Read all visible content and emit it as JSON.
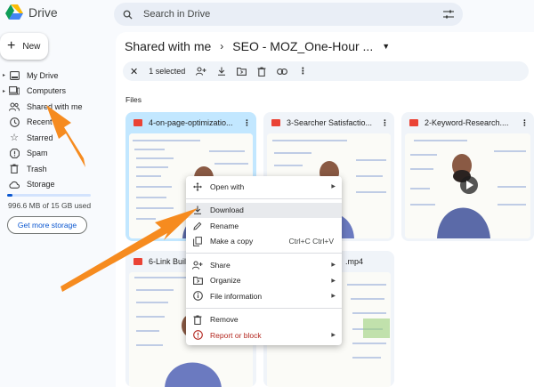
{
  "app": {
    "name": "Drive"
  },
  "search": {
    "placeholder": "Search in Drive"
  },
  "sidebar": {
    "new_label": "New",
    "items": [
      {
        "label": "My Drive",
        "icon": "my-drive-icon"
      },
      {
        "label": "Computers",
        "icon": "computer-icon"
      },
      {
        "label": "Shared with me",
        "icon": "shared-icon"
      },
      {
        "label": "Recent",
        "icon": "clock-icon"
      },
      {
        "label": "Starred",
        "icon": "star-icon"
      },
      {
        "label": "Spam",
        "icon": "spam-icon"
      },
      {
        "label": "Trash",
        "icon": "trash-icon"
      },
      {
        "label": "Storage",
        "icon": "cloud-icon"
      }
    ],
    "storage_fraction": 0.066,
    "storage_text": "996.6 MB of 15 GB used",
    "get_storage_label": "Get more storage"
  },
  "breadcrumb": {
    "root": "Shared with me",
    "current": "SEO - MOZ_One-Hour ..."
  },
  "toolbar": {
    "selected_text": "1 selected"
  },
  "files": {
    "section_label": "Files",
    "cards": [
      {
        "name": "4-on-page-optimizatio..."
      },
      {
        "name": "3-Searcher Satisfactio..."
      },
      {
        "name": "2-Keyword-Research...."
      },
      {
        "name": "6-Link Buil"
      },
      {
        "name": ".mp4"
      }
    ]
  },
  "context_menu": {
    "open_with": "Open with",
    "download": "Download",
    "rename": "Rename",
    "make_copy": "Make a copy",
    "make_copy_shortcut": "Ctrl+C Ctrl+V",
    "share": "Share",
    "organize": "Organize",
    "file_info": "File information",
    "remove": "Remove",
    "report": "Report or block"
  },
  "colors": {
    "accent": "#0b57d0",
    "selected_card": "#c2e7ff",
    "arrow": "#f68b1f",
    "danger": "#b3261e"
  }
}
